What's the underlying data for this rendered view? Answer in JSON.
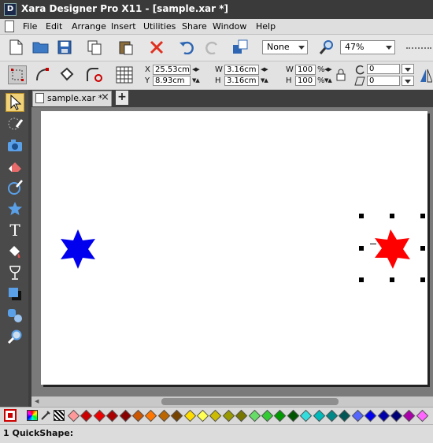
{
  "window": {
    "app_icon_letter": "D",
    "title": "Xara Designer Pro X11 - [sample.xar *]"
  },
  "menu": [
    "File",
    "Edit",
    "Arrange",
    "Insert",
    "Utilities",
    "Share",
    "Window",
    "Help"
  ],
  "toolbar": {
    "quality_value": "None",
    "zoom_value": "47%"
  },
  "infobar": {
    "x_label": "X",
    "x_value": "25.53cm",
    "y_label": "Y",
    "y_value": "8.93cm",
    "w_label": "W",
    "w_value": "3.16cm",
    "h_label": "H",
    "h_value": "3.16cm",
    "sw_label": "W",
    "sw_value": "100",
    "sh_label": "H",
    "sh_value": "100",
    "pct1": "%",
    "pct2": "%",
    "rotate_value": "0",
    "skew_value": "0"
  },
  "tabs": {
    "doc_tab": "sample.xar *",
    "close": "×",
    "add": "+"
  },
  "canvas": {
    "shapes": [
      {
        "kind": "star6",
        "color": "#0000ee"
      },
      {
        "kind": "star6",
        "color": "#ff0000",
        "selected": true
      }
    ]
  },
  "palette": {
    "colors": [
      "#ff9999",
      "#cc0000",
      "#ee0000",
      "#aa0000",
      "#880000",
      "#cc5500",
      "#ff7700",
      "#bb6600",
      "#774400",
      "#ffdd00",
      "#ffff55",
      "#ccbb00",
      "#999900",
      "#777700",
      "#66dd66",
      "#33cc33",
      "#009900",
      "#005500",
      "#33dddd",
      "#00bbbb",
      "#008888",
      "#005555",
      "#5566ff",
      "#0000ee",
      "#0000aa",
      "#000077",
      "#aa00aa",
      "#ff66ff"
    ]
  },
  "status": {
    "text": "1 QuickShape:"
  },
  "colors": {
    "title_bg": "#3a3a3a",
    "page_bg": "#ffffff",
    "canvas_bg": "#7a7a7a"
  }
}
